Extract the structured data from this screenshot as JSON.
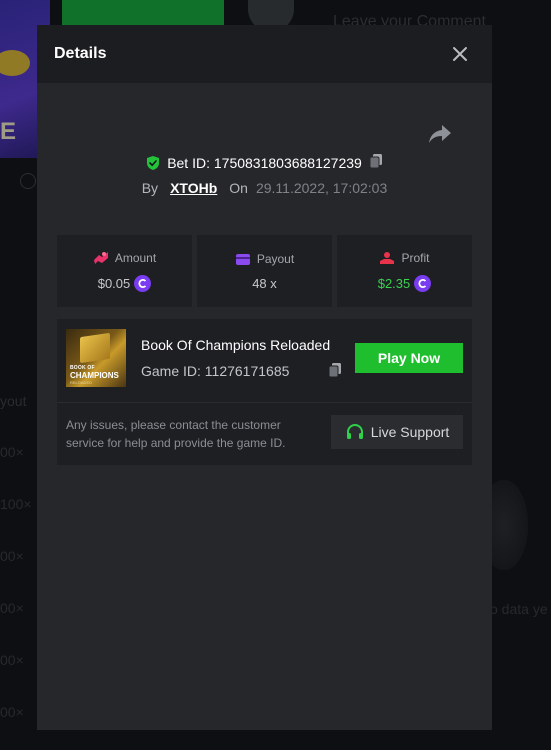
{
  "background": {
    "card_letter": "E",
    "comment_placeholder": "Leave your Comment",
    "payout_label": "yout",
    "multipliers": [
      "00×",
      "100×",
      "00×",
      "00×",
      "00×",
      "00×"
    ],
    "no_data": "o data ye"
  },
  "modal": {
    "title": "Details",
    "bet": {
      "label": "Bet ID: 1750831803688127239",
      "by_label": "By",
      "username": "XTOHb",
      "on_label": "On",
      "datetime": "29.11.2022, 17:02:03"
    },
    "stats": [
      {
        "label": "Amount",
        "value": "$0.05",
        "icon": "amount-icon",
        "color": "#e8336a"
      },
      {
        "label": "Payout",
        "value": "48 x",
        "icon": "wallet-icon",
        "color": "#8a4af0"
      },
      {
        "label": "Profit",
        "value": "$2.35",
        "icon": "profit-icon",
        "color": "#e8334a"
      }
    ],
    "game": {
      "name": "Book Of Champions Reloaded",
      "id_text": "Game ID: 11276171685",
      "play_label": "Play Now",
      "thumb_line1": "BOOK OF",
      "thumb_line2": "CHAMPIONS",
      "thumb_line3": "RELOADED"
    },
    "support": {
      "text": "Any issues, please contact the customer service for help and provide the game ID.",
      "button_label": "Live Support"
    }
  },
  "colors": {
    "accent_green": "#1fbe2e",
    "profit_green": "#3ad14f",
    "coin_purple": "#7a3cf0",
    "shield_green": "#22c33a"
  }
}
